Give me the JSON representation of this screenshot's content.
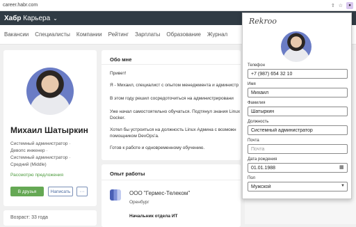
{
  "browser": {
    "url": "career.habr.com"
  },
  "header": {
    "brand_bold": "Хабр",
    "brand_rest": " Карьера"
  },
  "nav": {
    "items": [
      "Вакансии",
      "Специалисты",
      "Компании",
      "Рейтинг",
      "Зарплаты",
      "Образование",
      "Журнал"
    ]
  },
  "profile": {
    "name": "Михаил Шатыркин",
    "roles": [
      "Системный администратор ·",
      "Девопс инженер ·",
      "Системный администратор ·",
      "Средний (Middle)"
    ],
    "consider": "Рассмотрю предложения",
    "btn_friends": "В друзья",
    "btn_write": "Написать",
    "btn_more": "···",
    "age": "Возраст: 33 года"
  },
  "about": {
    "title": "Обо мне",
    "lines": [
      "Привет!",
      "Я - Михаил, специалист с опытом менеджмента и администр",
      "В этом году решил сосредоточиться на администрировани",
      "Уже начал самостоятельно обучаться. Подтянул знания Linux",
      "Docker.",
      "Хотел бы устроиться на должность Linux Админа с возможн",
      "помощником DevOps'а.",
      "Готов к работе и одновременному обучению."
    ]
  },
  "experience": {
    "title": "Опыт работы",
    "company": "ООО \"Гермес-Телеком\"",
    "city": "Оренбург",
    "position": "Начальник отдела ИТ"
  },
  "popup": {
    "logo": "Rekroo",
    "phone_label": "Телефон",
    "phone_value": "+7 (987) 654 32 10",
    "first_name_label": "Имя",
    "first_name_value": "Михаил",
    "last_name_label": "Фамилия",
    "last_name_value": "Шатыркин",
    "position_label": "Должность",
    "position_value": "Системный администратор",
    "email_label": "Почта",
    "email_placeholder": "Почта",
    "birth_label": "Дата рождения",
    "birth_value": "01.01.1988",
    "gender_label": "Пол",
    "gender_value": "Мужской"
  },
  "colors": {
    "header_bg": "#303b44",
    "accent_green": "#65a854",
    "link_blue": "#4a6aa0"
  }
}
